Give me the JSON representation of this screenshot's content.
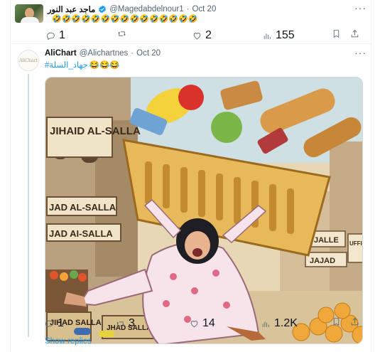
{
  "tweet1": {
    "author_name": "ماجد عبد النور",
    "handle": "@Magedabdelnour1",
    "separator": "·",
    "date": "Oct 20",
    "emojis": "🤣🤣🤣🤣🤣🤣🤣🤣🤣🤣🤣🤣🤣🤣🤣",
    "actions": {
      "replies": "1",
      "retweets": "",
      "likes": "2",
      "views": "155"
    }
  },
  "tweet2": {
    "avatar_text": "AliChart",
    "author_name": "AliChart",
    "handle": "@Alichartnes",
    "separator": "·",
    "date": "Oct 20",
    "hashtag": "#جهاد_السلة",
    "emojis": "😂😂😂",
    "media_labels": {
      "sign_top": "JIHAID AL-SALLA",
      "sign_mid": "JAD AL-SALLA",
      "sign_low": "JAD AI-SALLA",
      "crate_left": "JIHAD SALLA",
      "crate_mid": "JHAD SALLA",
      "sign_right_top": "JALLE",
      "sign_right_mid": "JAJAD",
      "sign_far_right": "UFFI"
    },
    "actions": {
      "replies": "1",
      "retweets": "3",
      "likes": "14",
      "views": "1.2K"
    }
  },
  "show_replies": "Show replies",
  "colors": {
    "accent": "#1d9bf0",
    "muted": "#536471",
    "border": "#eff3f4"
  }
}
